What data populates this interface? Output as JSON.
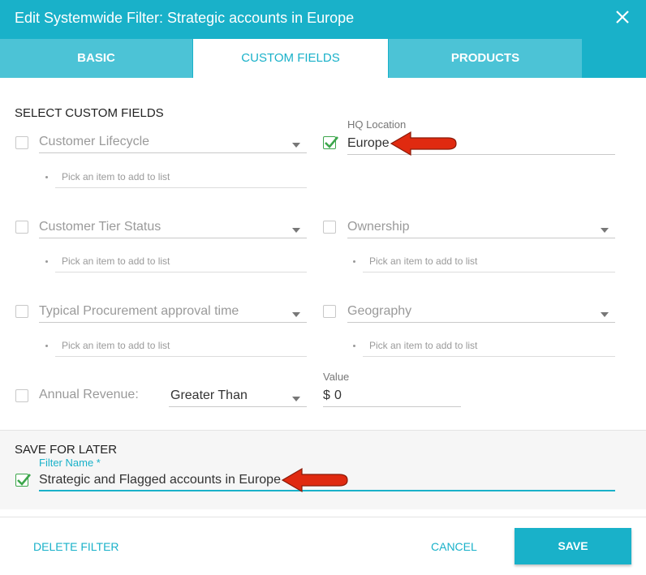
{
  "dialog": {
    "title": "Edit Systemwide Filter: Strategic accounts in Europe",
    "close_icon": "close-icon"
  },
  "tabs": [
    {
      "label": "BASIC",
      "active": false
    },
    {
      "label": "CUSTOM FIELDS",
      "active": true
    },
    {
      "label": "PRODUCTS",
      "active": false
    }
  ],
  "custom_fields": {
    "section_title": "SELECT CUSTOM FIELDS",
    "pick_placeholder": "Pick an item to add to list",
    "fields": {
      "customer_lifecycle": {
        "label": "Customer Lifecycle",
        "checked": false
      },
      "hq_location": {
        "label": "HQ Location",
        "value": "Europe",
        "checked": true
      },
      "customer_tier_status": {
        "label": "Customer Tier Status",
        "checked": false
      },
      "ownership": {
        "label": "Ownership",
        "checked": false
      },
      "typical_procurement": {
        "label": "Typical Procurement approval time",
        "checked": false
      },
      "geography": {
        "label": "Geography",
        "checked": false
      }
    },
    "annual_revenue": {
      "label": "Annual Revenue:",
      "checked": false,
      "operator": "Greater Than",
      "value_label": "Value",
      "currency": "$",
      "value": "0"
    }
  },
  "save_for_later": {
    "section_title": "SAVE FOR LATER",
    "filter_name_label": "Filter Name *",
    "filter_name_value": "Strategic and Flagged accounts in Europe",
    "checked": true
  },
  "footer": {
    "delete_label": "DELETE FILTER",
    "cancel_label": "CANCEL",
    "save_label": "SAVE"
  },
  "colors": {
    "accent": "#19b1c9",
    "tab_inactive": "#4cc3d6",
    "check_green": "#3ca64b",
    "annotation_arrow": "#e02a10"
  }
}
